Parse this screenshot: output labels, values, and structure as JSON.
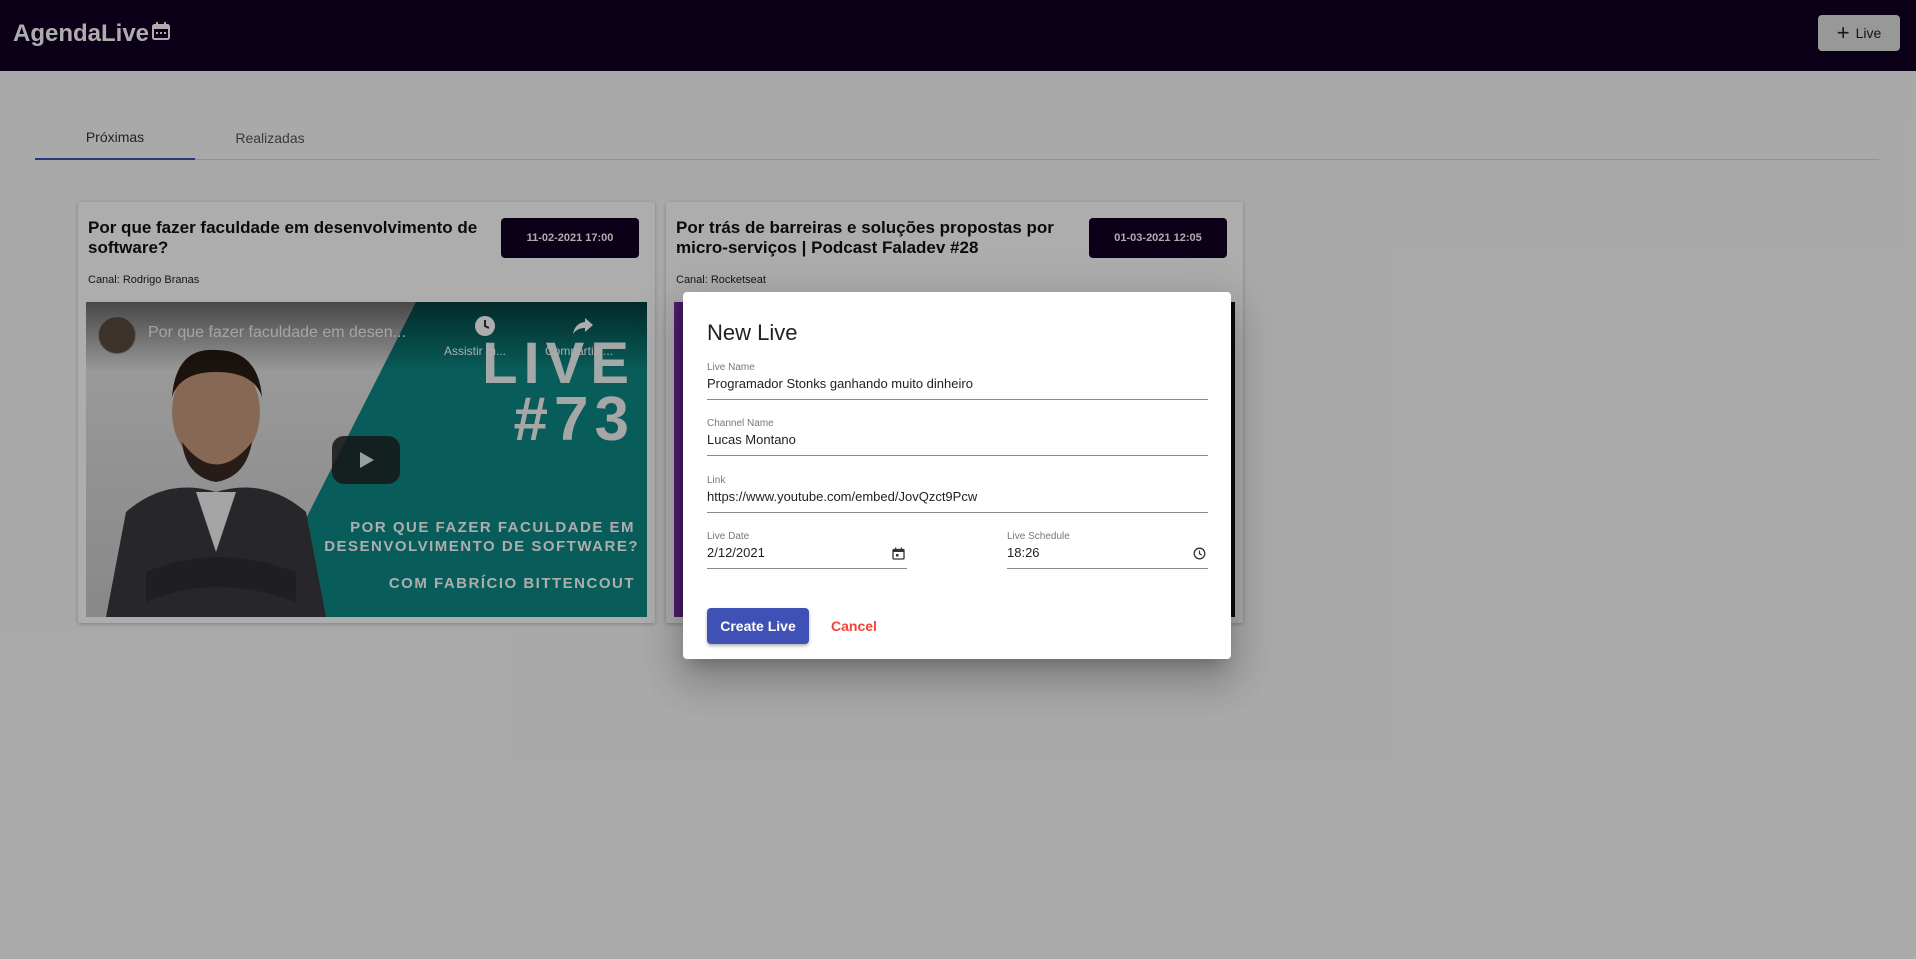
{
  "app": {
    "title": "AgendaLive",
    "add_button_label": "Live"
  },
  "tabs": [
    {
      "label": "Próximas",
      "active": true
    },
    {
      "label": "Realizadas",
      "active": false
    }
  ],
  "cards": [
    {
      "title": "Por que fazer faculdade em desenvolvimento de software?",
      "date": "11-02-2021 17:00",
      "channel": "Canal: Rodrigo Branas",
      "video": {
        "title": "Por que fazer faculdade em desen...",
        "watch_later": "Assistir m...",
        "share": "Compartilh...",
        "thumb_big": "LIVE",
        "thumb_number": "#73",
        "thumb_line1": "POR QUE FAZER FACULDADE EM",
        "thumb_line2": "DESENVOLVIMENTO DE SOFTWARE?",
        "thumb_line3": "COM FABRÍCIO BITTENCOUT"
      }
    },
    {
      "title": "Por trás de barreiras e soluções propostas por micro-serviços | Podcast Faladev #28",
      "date": "01-03-2021 12:05",
      "channel": "Canal: Rocketseat"
    }
  ],
  "dialog": {
    "title": "New Live",
    "live_name_label": "Live Name",
    "live_name_value": "Programador Stonks ganhando muito dinheiro",
    "channel_label": "Channel Name",
    "channel_value": "Lucas Montano",
    "link_label": "Link",
    "link_value": "https://www.youtube.com/embed/JovQzct9Pcw",
    "date_label": "Live Date",
    "date_value": "2/12/2021",
    "schedule_label": "Live Schedule",
    "schedule_value": "18:26",
    "create_label": "Create Live",
    "cancel_label": "Cancel"
  },
  "colors": {
    "topbar": "#120024",
    "primary": "#3f51b5",
    "cancel": "#f44336",
    "badge": "#120024"
  }
}
